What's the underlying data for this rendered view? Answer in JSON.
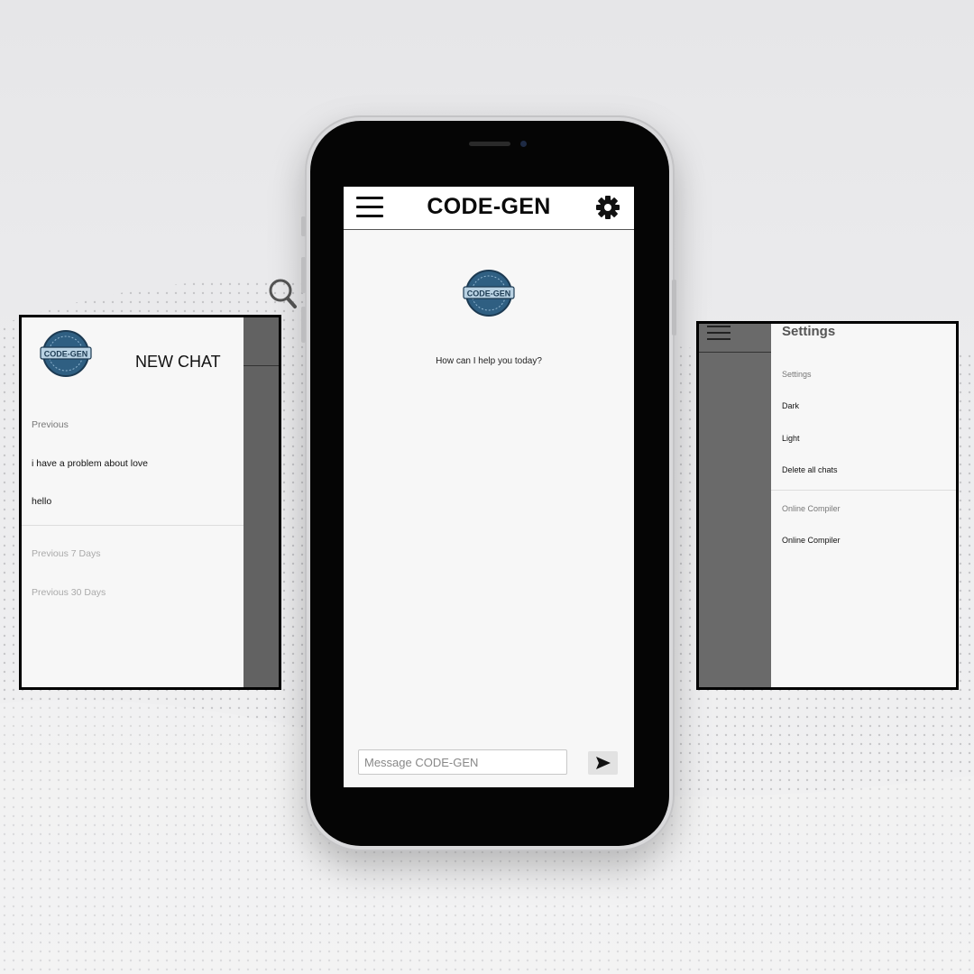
{
  "app": {
    "title": "CODE-GEN",
    "logo_text": "CODE-GEN",
    "greeting": "How can I help you today?",
    "message_placeholder": "Message CODE-GEN",
    "icons": {
      "menu": "hamburger-icon",
      "settings": "gear-icon",
      "send": "send-icon",
      "search": "search-icon"
    }
  },
  "drawer": {
    "new_chat_label": "NEW CHAT",
    "sections": [
      {
        "label": "Previous",
        "items": [
          "i have a problem about love",
          "hello"
        ]
      },
      {
        "label": "Previous 7 Days",
        "items": []
      },
      {
        "label": "Previous 30 Days",
        "items": []
      }
    ]
  },
  "settings": {
    "title": "Settings",
    "sections": [
      {
        "label": "Settings",
        "items": [
          "Dark",
          "Light",
          "Delete all chats"
        ]
      },
      {
        "label": "Online Compiler",
        "items": [
          "Online Compiler"
        ]
      }
    ]
  },
  "colors": {
    "header_bg": "#ffffff",
    "screen_bg": "#f7f7f7",
    "overlay_dim": "#626262",
    "logo_blue": "#3a6f96"
  }
}
